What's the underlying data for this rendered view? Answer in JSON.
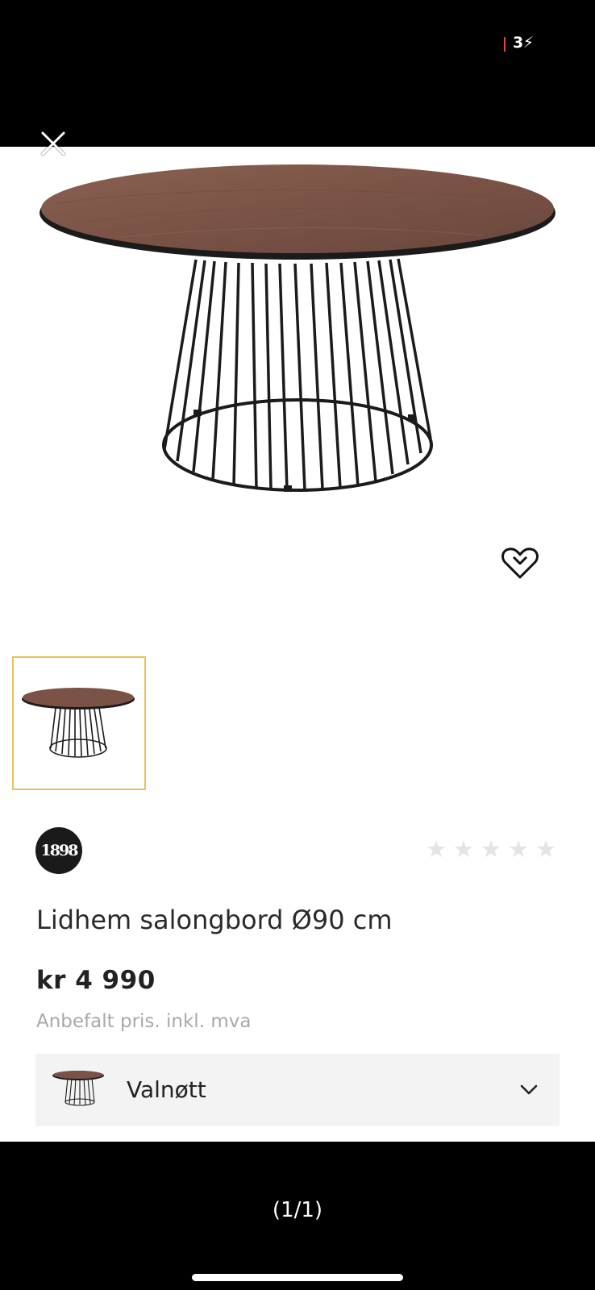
{
  "status_bar": {
    "network": "3⚡"
  },
  "gallery": {
    "close_icon": "close-icon",
    "favorite_icon": "heart-icon",
    "thumbnail_count": 1
  },
  "product": {
    "brand_logo_text": "1898",
    "rating": {
      "stars_filled": 0,
      "stars_total": 5,
      "star_color": "#e4e4e4"
    },
    "title": "Lidhem salongbord Ø90 cm",
    "price": "kr 4 990",
    "price_note": "Anbefalt pris. inkl. mva"
  },
  "variant_selector": {
    "selected_label": "Valnøtt",
    "chevron_icon": "chevron-down-icon"
  },
  "viewer": {
    "page_counter": "(1/1)"
  },
  "colors": {
    "thumbnail_border": "#e8c25b",
    "wood": "#7a5346",
    "metal": "#1b1b1b",
    "variant_bg": "#f3f3f3",
    "price_note": "#a9a9a9"
  }
}
